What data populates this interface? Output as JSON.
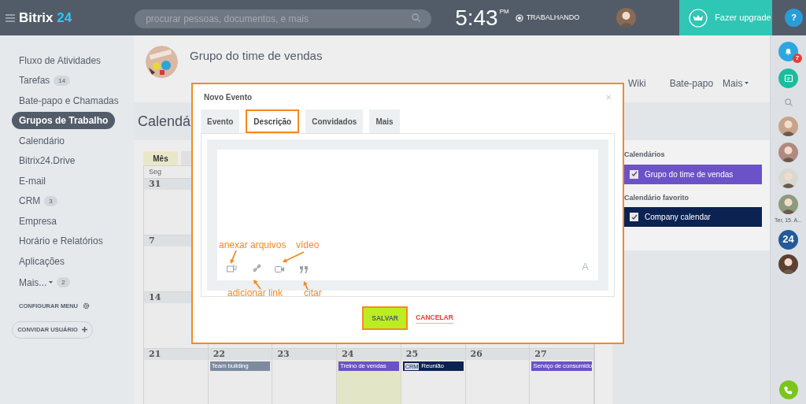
{
  "topbar": {
    "logo": {
      "name": "Bitrix",
      "number": "24"
    },
    "search": {
      "placeholder": "procurar pessoas, documentos, e mais"
    },
    "clock": {
      "time": "5:43",
      "period": "PM"
    },
    "status": "TRABALHANDO",
    "upgrade": "Fazer upgrade",
    "help": "?"
  },
  "sidebar": {
    "items": [
      {
        "label": "Fluxo de Atividades",
        "selected": false
      },
      {
        "label": "Tarefas",
        "counter": "14",
        "selected": false
      },
      {
        "label": "Bate-papo e Chamadas",
        "selected": false
      },
      {
        "label": "Grupos de Trabalho",
        "selected": true
      },
      {
        "label": "Calendário",
        "selected": false
      },
      {
        "label": "Bitrix24.Drive",
        "selected": false
      },
      {
        "label": "E-mail",
        "selected": false
      },
      {
        "label": "CRM",
        "counter": "3",
        "selected": false
      },
      {
        "label": "Empresa",
        "selected": false
      },
      {
        "label": "Horário e Relatórios",
        "selected": false
      },
      {
        "label": "Aplicações",
        "selected": false
      }
    ],
    "more": {
      "label": "Mais...",
      "counter": "2"
    },
    "configure": "CONFIGURAR MENU",
    "invite": "CONVIDAR USUÁRIO"
  },
  "group": {
    "title": "Grupo do time de vendas",
    "tabs": [
      {
        "label": "Wiki"
      },
      {
        "label": "Bate-papo"
      }
    ],
    "more_tab": "Mais"
  },
  "page_title": "Calendá",
  "calendar": {
    "view_tab": {
      "label": "Mês",
      "selected": true
    },
    "weekday": "Seg",
    "weeks": [
      "31",
      "7",
      "14"
    ],
    "last_week": [
      {
        "day": "21",
        "today": false
      },
      {
        "day": "22",
        "today": false,
        "events": [
          {
            "title": "Team building",
            "color": "#7d8ba1"
          }
        ]
      },
      {
        "day": "23",
        "today": false
      },
      {
        "day": "24",
        "today": true,
        "events": [
          {
            "title": "Treino de vendas",
            "color": "#6b52c8"
          }
        ]
      },
      {
        "day": "25",
        "today": false,
        "events": [
          {
            "title": "Reunião",
            "tag": "CRM",
            "color": "#0c2352"
          }
        ]
      },
      {
        "day": "26",
        "today": false
      },
      {
        "day": "27",
        "today": false,
        "events": [
          {
            "title": "Serviço de consumido",
            "color": "#6b52c8"
          }
        ]
      }
    ]
  },
  "calendars": [
    {
      "heading": "Calendários",
      "items": [
        {
          "name": "Grupo do time de vendas",
          "checked": true,
          "color": "#6b52c8"
        }
      ]
    },
    {
      "heading": "Calendário favorito",
      "items": [
        {
          "name": "Company calendar",
          "checked": true,
          "color": "#0c2352"
        }
      ]
    }
  ],
  "right_rail": {
    "notifications": "7",
    "date": "Ter, 15. A...",
    "app_badge": "24"
  },
  "modal": {
    "title": "Novo Evento",
    "close": "×",
    "tabs": [
      {
        "label": "Evento",
        "selected": false
      },
      {
        "label": "Descrição",
        "selected": true
      },
      {
        "label": "Convidados",
        "selected": false
      },
      {
        "label": "Mais",
        "selected": false
      }
    ],
    "format_button": "A",
    "annotations": [
      {
        "text": "anexar arquivos"
      },
      {
        "text": "vídeo"
      },
      {
        "text": "adicionar link"
      },
      {
        "text": "citar"
      }
    ],
    "save": "SALVAR",
    "cancel": "CANCELAR"
  }
}
